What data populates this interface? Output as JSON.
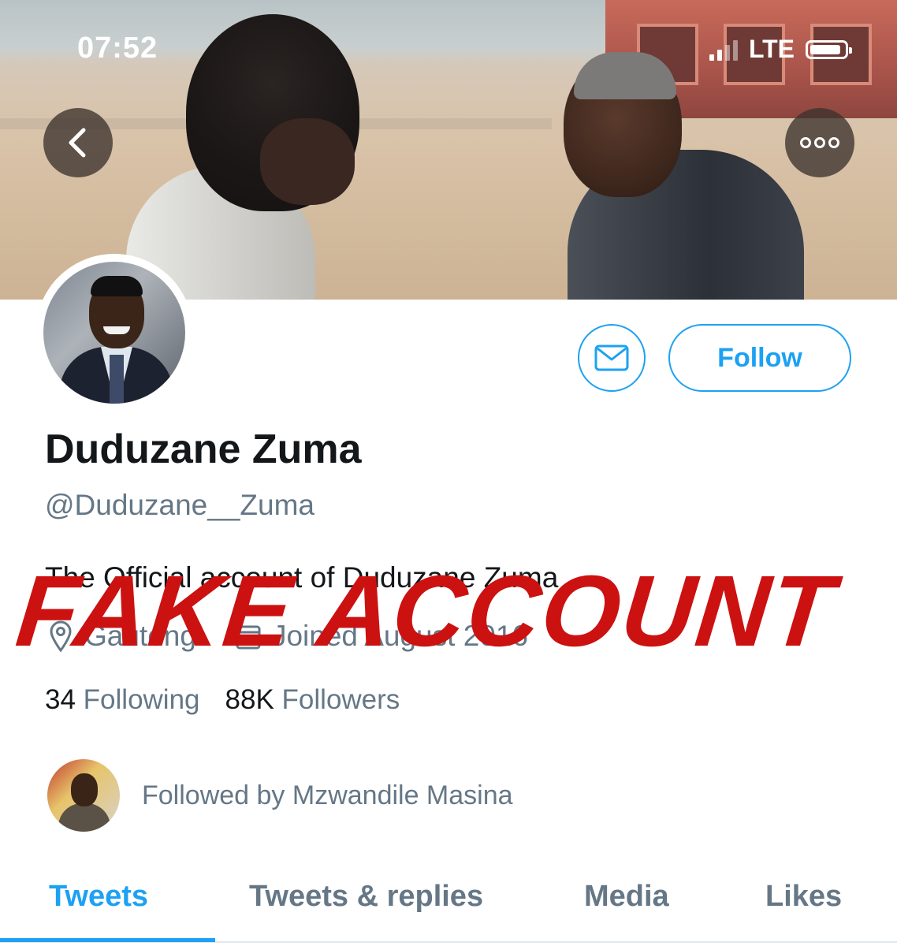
{
  "status_bar": {
    "time": "07:52",
    "network": "LTE",
    "signal_bars_filled": 2,
    "signal_bars_total": 4,
    "battery_fill": 0.9
  },
  "header": {
    "back_icon": "chevron-left-icon",
    "more_icon": "more-dots-icon"
  },
  "profile": {
    "name": "Duduzane Zuma",
    "handle": "@Duduzane__Zuma",
    "bio": "The Official account of Duduzane Zuma",
    "location": "Gauteng",
    "joined": "Joined August 2016",
    "following_count": "34",
    "following_label": "Following",
    "followers_count": "88K",
    "followers_label": "Followers",
    "followed_by": "Followed by Mzwandile Masina"
  },
  "actions": {
    "message_icon": "mail-icon",
    "follow_label": "Follow"
  },
  "tabs": [
    {
      "label": "Tweets",
      "active": true
    },
    {
      "label": "Tweets & replies",
      "active": false
    },
    {
      "label": "Media",
      "active": false
    },
    {
      "label": "Likes",
      "active": false
    }
  ],
  "overlay": {
    "stamp_text": "FAKE ACCOUNT"
  },
  "colors": {
    "accent": "#1da1f2",
    "stamp": "#cc1111",
    "text_primary": "#14171a",
    "text_secondary": "#657786"
  }
}
